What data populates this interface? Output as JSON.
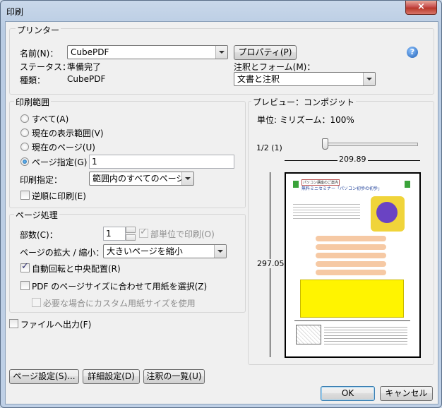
{
  "window": {
    "title": "印刷",
    "close_glyph": "×"
  },
  "printer": {
    "group_label": "プリンター",
    "name_label": "名前(N)：",
    "name_value": "CubePDF",
    "properties_button": "プロパティ(P)",
    "status_label": "ステータス：",
    "status_value": "準備完了",
    "type_label": "種類：",
    "type_value": "CubePDF",
    "comments_forms_label": "注釈とフォーム(M)：",
    "comments_forms_value": "文書と注釈",
    "help_glyph": "?"
  },
  "range": {
    "group_label": "印刷範囲",
    "all": "すべて(A)",
    "current_view": "現在の表示範囲(V)",
    "current_page": "現在のページ(U)",
    "pages": "ページ指定(G)",
    "pages_value": "1",
    "subset_label": "印刷指定：",
    "subset_value": "範囲内のすべてのページ",
    "reverse": "逆順に印刷(E)"
  },
  "handling": {
    "group_label": "ページ処理",
    "copies_label": "部数(C)：",
    "copies_value": "1",
    "collate": "部単位で印刷(O)",
    "scaling_label": "ページの拡大 / 縮小：",
    "scaling_value": "大きいページを縮小",
    "auto_rotate": "自動回転と中央配置(R)",
    "choose_paper": "PDF のページサイズに合わせて用紙を選択(Z)",
    "custom_paper": "必要な場合にカスタム用紙サイズを使用"
  },
  "print_to_file": "ファイルへ出力(F)",
  "preview": {
    "group_label": "プレビュー：コンポジット",
    "units": "単位: ミリズーム：100%",
    "page_indicator": "1/2 (1)",
    "width": "209.89",
    "height": "297.05",
    "doc_title": "無料ミニセミナー「パソコン初歩の初歩」",
    "doc_tag": "パソコン講座のご案内"
  },
  "footer": {
    "page_setup": "ページ設定(S)...",
    "advanced": "詳細設定(D)",
    "summarize": "注釈の一覧(U)",
    "ok": "OK",
    "cancel": "キャンセル"
  }
}
